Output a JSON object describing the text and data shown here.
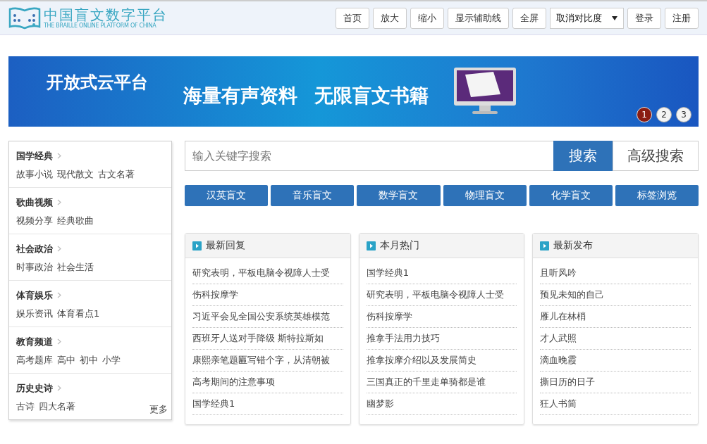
{
  "header": {
    "logo_title": "中国盲文数字平台",
    "logo_subtitle": "THE BRAILLE ONLINE PLATFORM OF CHINA",
    "buttons": [
      {
        "label": "首页",
        "kind": "button"
      },
      {
        "label": "放大",
        "kind": "button"
      },
      {
        "label": "缩小",
        "kind": "button"
      },
      {
        "label": "显示辅助线",
        "kind": "button"
      },
      {
        "label": "全屏",
        "kind": "button"
      },
      {
        "label": "取消对比度",
        "kind": "select"
      },
      {
        "label": "登录",
        "kind": "button"
      },
      {
        "label": "注册",
        "kind": "button"
      }
    ]
  },
  "banner": {
    "title": "开放式云平台",
    "slogan_1": "海量有声资料",
    "slogan_2": "无限盲文书籍",
    "dots": [
      {
        "label": "1",
        "selected": true
      },
      {
        "label": "2",
        "selected": false
      },
      {
        "label": "3",
        "selected": false
      }
    ]
  },
  "sidebar": {
    "categories": [
      {
        "title": "国学经典",
        "links": [
          "故事小说",
          "现代散文",
          "古文名著"
        ]
      },
      {
        "title": "歌曲视频",
        "links": [
          "视频分享",
          "经典歌曲"
        ]
      },
      {
        "title": "社会政治",
        "links": [
          "时事政治",
          "社会生活"
        ]
      },
      {
        "title": "体育娱乐",
        "links": [
          "娱乐资讯",
          "体育看点1"
        ]
      },
      {
        "title": "教育频道",
        "links": [
          "高考题库",
          "高中",
          "初中",
          "小学"
        ]
      },
      {
        "title": "历史史诗",
        "links": [
          "古诗",
          "四大名著"
        ]
      }
    ],
    "more": "更多"
  },
  "search": {
    "placeholder": "输入关键字搜索",
    "search_button": "搜索",
    "advanced_button": "高级搜索"
  },
  "category_buttons": [
    "汉英盲文",
    "音乐盲文",
    "数学盲文",
    "物理盲文",
    "化学盲文",
    "标签浏览"
  ],
  "panels": [
    {
      "title": "最新回复",
      "items": [
        "研究表明，平板电脑令视障人士受",
        "伤科按摩学",
        "习近平会见全国公安系统英雄模范",
        "西班牙人送对手降级 斯特拉斯如",
        "康熙亲笔题匾写错个字，从清朝被",
        "高考期间的注意事项",
        "国学经典1"
      ]
    },
    {
      "title": "本月热门",
      "items": [
        "国学经典1",
        "研究表明，平板电脑令视障人士受",
        "伤科按摩学",
        "推拿手法用力技巧",
        "推拿按摩介绍以及发展简史",
        "三国真正的千里走单骑都是谁",
        "幽梦影"
      ]
    },
    {
      "title": "最新发布",
      "items": [
        "且听风吟",
        "预见未知的自己",
        "雁儿在林梢",
        "才人武照",
        "滴血晚霞",
        "撕日历的日子",
        "狂人书简"
      ]
    }
  ]
}
